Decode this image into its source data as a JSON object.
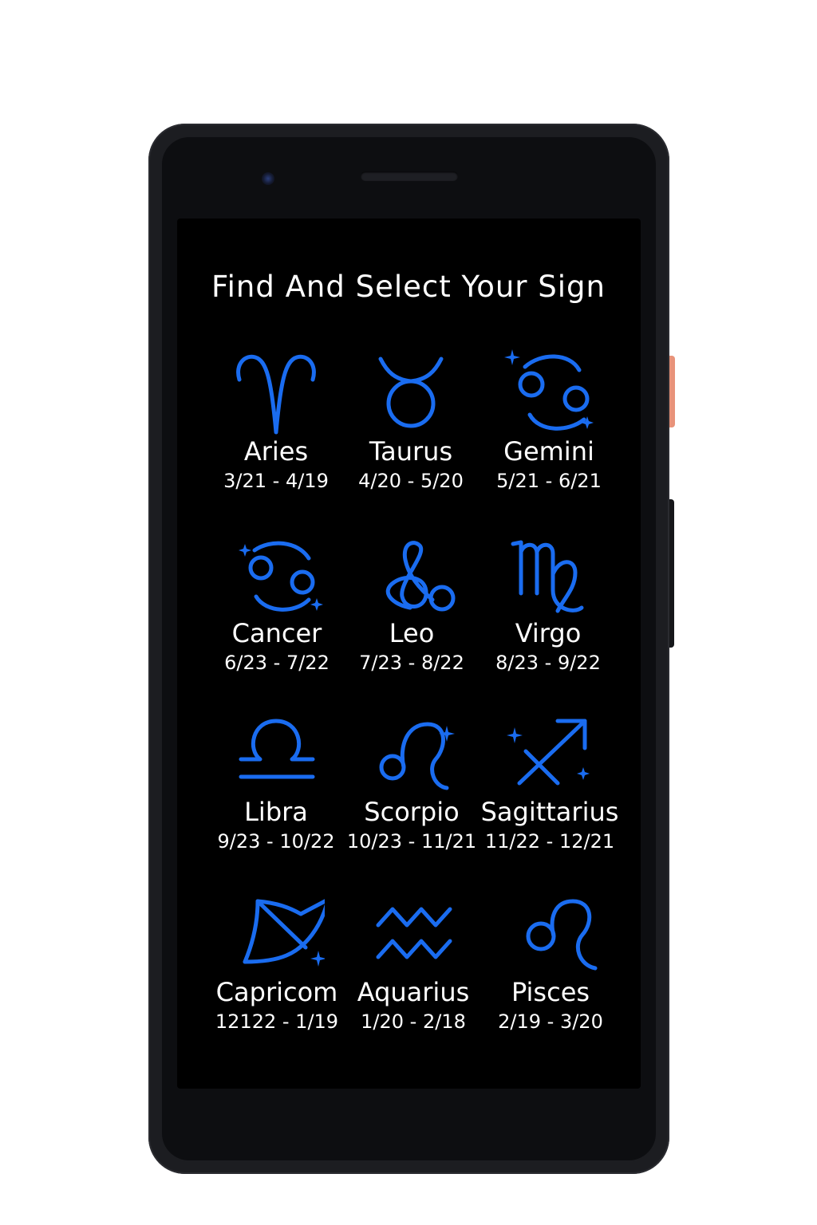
{
  "screen": {
    "title": "Find And Select Your Sign"
  },
  "signs": [
    {
      "name": "Aries",
      "dates": "3/21 - 4/19",
      "icon": "aries-icon"
    },
    {
      "name": "Taurus",
      "dates": "4/20 - 5/20",
      "icon": "taurus-icon"
    },
    {
      "name": "Gemini",
      "dates": "5/21 - 6/21",
      "icon": "cancer-style-icon"
    },
    {
      "name": "Cancer",
      "dates": "6/23 - 7/22",
      "icon": "cancer-icon"
    },
    {
      "name": "Leo",
      "dates": "7/23 - 8/22",
      "icon": "leo-loop-icon"
    },
    {
      "name": "Virgo",
      "dates": "8/23 - 9/22",
      "icon": "virgo-icon"
    },
    {
      "name": "Libra",
      "dates": "9/23 - 10/22",
      "icon": "libra-icon"
    },
    {
      "name": "Scorpio",
      "dates": "10/23 - 11/21",
      "icon": "leo-icon"
    },
    {
      "name": "Sagittarius",
      "dates": "11/22 - 12/21",
      "icon": "sagittarius-icon"
    },
    {
      "name": "Capricom",
      "dates": "12122 - 1/19",
      "icon": "capricorn-bow-icon"
    },
    {
      "name": "Aquarius",
      "dates": "1/20 - 2/18",
      "icon": "aquarius-icon"
    },
    {
      "name": "Pisces",
      "dates": "2/19 - 3/20",
      "icon": "leo-icon"
    }
  ],
  "colors": {
    "icon": "#1a6cf0",
    "background": "#000000",
    "text": "#ffffff"
  }
}
